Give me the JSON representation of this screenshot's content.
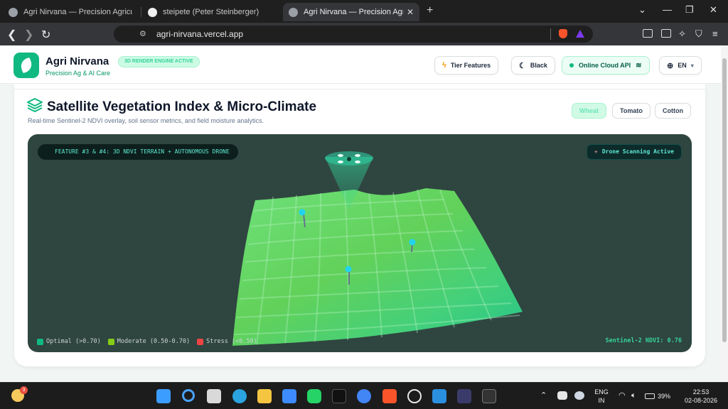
{
  "browser": {
    "tabs": [
      {
        "title": "Agri Nirvana — Precision Agriculture",
        "active": false
      },
      {
        "title": "steipete (Peter Steinberger)",
        "active": false
      },
      {
        "title": "Agri Nirvana — Precision Agricul",
        "active": true
      }
    ],
    "url": "agri-nirvana.vercel.app"
  },
  "header": {
    "brand": "Agri Nirvana",
    "tagline": "Precision Ag & AI Care",
    "engine_badge": "3D RENDER ENGINE ACTIVE",
    "tier_button": "Tier Features",
    "theme_button": "Black",
    "cloud_status": "Online Cloud API",
    "language": "EN"
  },
  "section": {
    "title": "Satellite Vegetation Index & Micro-Climate",
    "subtitle": "Real-time Sentinel-2 NDVI overlay, soil sensor metrics, and field moisture analytics.",
    "crops": [
      "Wheat",
      "Tomato",
      "Cotton"
    ],
    "selected_crop": "Wheat"
  },
  "viewport": {
    "feature_badge": "FEATURE #3 & #4: 3D NDVI TERRAIN + AUTONOMOUS DRONE",
    "drone_status": "Drone Scanning Active",
    "legend": [
      {
        "label": "Optimal (>0.70)",
        "color": "#10b981"
      },
      {
        "label": "Moderate (0.50-0.70)",
        "color": "#84cc16"
      },
      {
        "label": "Stress (<0.50)",
        "color": "#ef4444"
      }
    ],
    "ndvi_readout": "Sentinel-2 NDVI: 0.76"
  },
  "taskbar": {
    "notification_count": "3",
    "language": "ENG",
    "region": "IN",
    "battery": "39%",
    "time": "22:53",
    "date": "02-08-2026"
  },
  "colors": {
    "accent": "#10b981",
    "page_bg": "#f1f5f3",
    "viewport_bg": "#2f4540"
  }
}
